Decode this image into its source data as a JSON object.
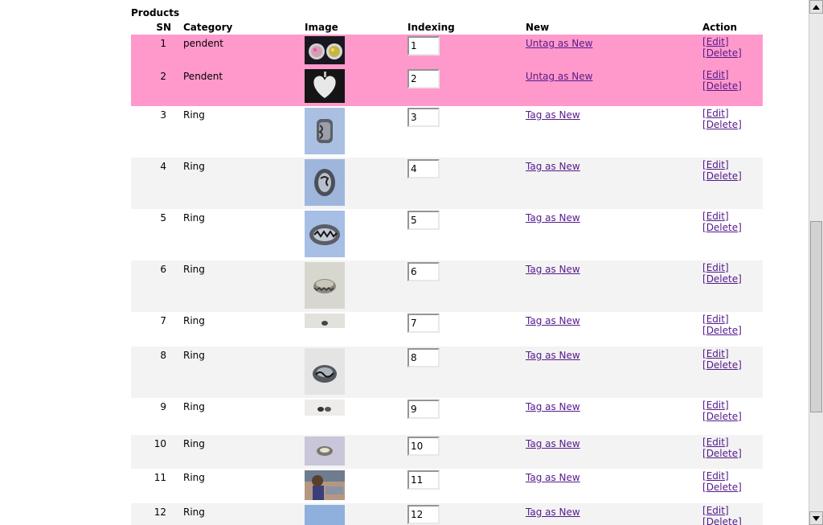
{
  "section_title": "Products",
  "headers": {
    "sn": "SN",
    "category": "Category",
    "image": "Image",
    "indexing": "Indexing",
    "new": "New",
    "action": "Action"
  },
  "rows": [
    {
      "sn": "1",
      "category": "pendent",
      "indexing": "1",
      "new_label": "Untag as New",
      "edit": "Edit",
      "delete": "Delete"
    },
    {
      "sn": "2",
      "category": "Pendent",
      "indexing": "2",
      "new_label": "Untag as New",
      "edit": "Edit",
      "delete": "Delete"
    },
    {
      "sn": "3",
      "category": "Ring",
      "indexing": "3",
      "new_label": "Tag as New",
      "edit": "Edit",
      "delete": "Delete"
    },
    {
      "sn": "4",
      "category": "Ring",
      "indexing": "4",
      "new_label": "Tag as New",
      "edit": "Edit",
      "delete": "Delete"
    },
    {
      "sn": "5",
      "category": "Ring",
      "indexing": "5",
      "new_label": "Tag as New",
      "edit": "Edit",
      "delete": "Delete"
    },
    {
      "sn": "6",
      "category": "Ring",
      "indexing": "6",
      "new_label": "Tag as New",
      "edit": "Edit",
      "delete": "Delete"
    },
    {
      "sn": "7",
      "category": "Ring",
      "indexing": "7",
      "new_label": "Tag as New",
      "edit": "Edit",
      "delete": "Delete"
    },
    {
      "sn": "8",
      "category": "Ring",
      "indexing": "8",
      "new_label": "Tag as New",
      "edit": "Edit",
      "delete": "Delete"
    },
    {
      "sn": "9",
      "category": "Ring",
      "indexing": "9",
      "new_label": "Tag as New",
      "edit": "Edit",
      "delete": "Delete"
    },
    {
      "sn": "10",
      "category": "Ring",
      "indexing": "10",
      "new_label": "Tag as New",
      "edit": "Edit",
      "delete": "Delete"
    },
    {
      "sn": "11",
      "category": "Ring",
      "indexing": "11",
      "new_label": "Tag as New",
      "edit": "Edit",
      "delete": "Delete"
    },
    {
      "sn": "12",
      "category": "Ring",
      "indexing": "12",
      "new_label": "Tag as New",
      "edit": "Edit",
      "delete": "Delete"
    }
  ],
  "colors": {
    "highlight_row": "#ff99cc",
    "alt_row": "#f3f3f3",
    "link": "#551a8b"
  }
}
